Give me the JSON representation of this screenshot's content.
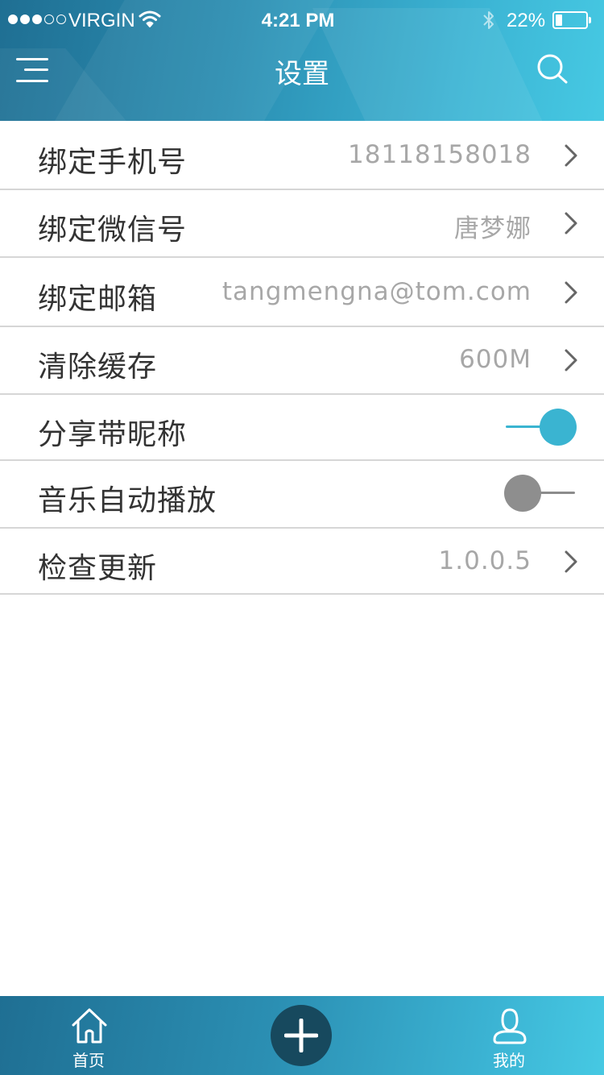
{
  "status_bar": {
    "carrier": "VIRGIN",
    "time": "4:21 PM",
    "battery": "22%",
    "signal_strength": 3,
    "signal_total": 5
  },
  "header": {
    "title": "设置"
  },
  "settings": [
    {
      "label": "绑定手机号",
      "value": "18118158018",
      "type": "link"
    },
    {
      "label": "绑定微信号",
      "value": "唐梦娜",
      "type": "link"
    },
    {
      "label": "绑定邮箱",
      "value": "tangmengna@tom.com",
      "type": "link"
    },
    {
      "label": "清除缓存",
      "value": "600M",
      "type": "link"
    },
    {
      "label": "分享带昵称",
      "type": "toggle",
      "state": "on"
    },
    {
      "label": "音乐自动播放",
      "type": "toggle",
      "state": "off"
    },
    {
      "label": "检查更新",
      "value": "1.0.0.5",
      "type": "link"
    }
  ],
  "tabbar": {
    "home_label": "首页",
    "mine_label": "我的"
  },
  "colors": {
    "accent": "#3ab4d1",
    "header_start": "#1f6f93",
    "header_end": "#46c9e3",
    "add_button": "#17495e",
    "toggle_off": "#8e8e8e"
  },
  "icons": [
    "menu-icon",
    "search-icon",
    "chevron-right-icon",
    "home-icon",
    "plus-icon",
    "user-icon",
    "wifi-icon",
    "bluetooth-icon",
    "battery-icon"
  ]
}
